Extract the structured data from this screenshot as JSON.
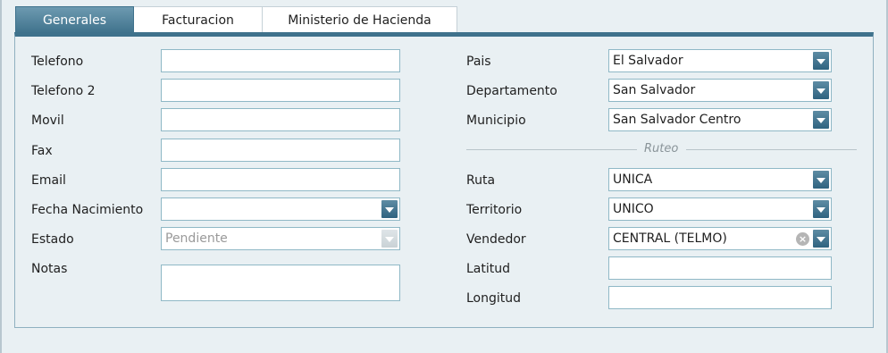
{
  "tabs": [
    {
      "label": "Generales",
      "active": true
    },
    {
      "label": "Facturacion",
      "active": false
    },
    {
      "label": "Ministerio de Hacienda",
      "active": false
    }
  ],
  "left": {
    "telefono_label": "Telefono",
    "telefono2_label": "Telefono 2",
    "movil_label": "Movil",
    "fax_label": "Fax",
    "email_label": "Email",
    "fecha_label": "Fecha Nacimiento",
    "estado_label": "Estado",
    "estado_value": "Pendiente",
    "notas_label": "Notas"
  },
  "right": {
    "pais_label": "Pais",
    "pais_value": "El Salvador",
    "departamento_label": "Departamento",
    "departamento_value": "San Salvador",
    "municipio_label": "Municipio",
    "municipio_value": "San Salvador Centro",
    "separator_label": "Ruteo",
    "ruta_label": "Ruta",
    "ruta_value": "UNICA",
    "territorio_label": "Territorio",
    "territorio_value": "UNICO",
    "vendedor_label": "Vendedor",
    "vendedor_value": "CENTRAL (TELMO)",
    "latitud_label": "Latitud",
    "longitud_label": "Longitud"
  },
  "colors": {
    "accent": "#3f728c",
    "field_border": "#8fb8c6",
    "background": "#e9f0f3"
  },
  "icons": {
    "dropdown": "chevron-down-icon",
    "clear": "clear-icon"
  }
}
